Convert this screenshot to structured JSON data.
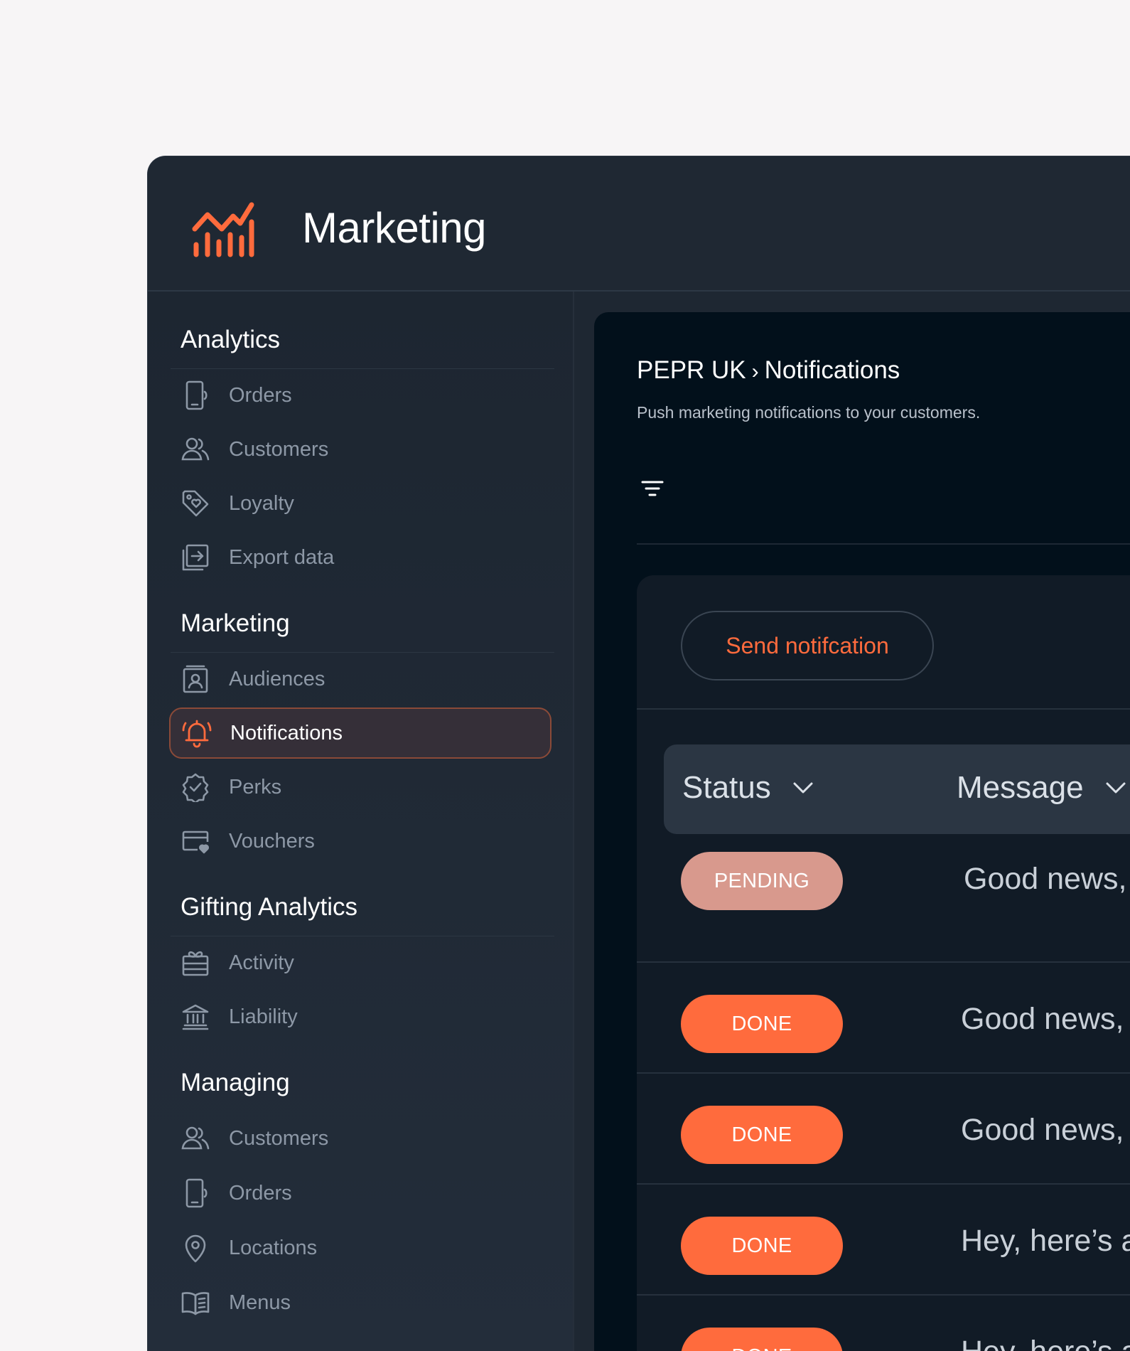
{
  "app": {
    "title": "Marketing",
    "accent_color": "#ff6b3d",
    "logo_icon": "chart-growth-icon"
  },
  "sidebar": {
    "sections": [
      {
        "title": "Analytics",
        "items": [
          {
            "label": "Orders",
            "icon": "phone-order-icon"
          },
          {
            "label": "Customers",
            "icon": "users-icon"
          },
          {
            "label": "Loyalty",
            "icon": "tag-heart-icon"
          },
          {
            "label": "Export data",
            "icon": "export-icon"
          }
        ]
      },
      {
        "title": "Marketing",
        "items": [
          {
            "label": "Audiences",
            "icon": "contact-card-icon"
          },
          {
            "label": "Notifications",
            "icon": "bell-icon",
            "active": true
          },
          {
            "label": "Perks",
            "icon": "badge-check-icon"
          },
          {
            "label": "Vouchers",
            "icon": "card-heart-icon"
          }
        ]
      },
      {
        "title": "Gifting Analytics",
        "items": [
          {
            "label": "Activity",
            "icon": "gift-card-icon"
          },
          {
            "label": "Liability",
            "icon": "bank-icon"
          }
        ]
      },
      {
        "title": "Managing",
        "items": [
          {
            "label": "Customers",
            "icon": "users-icon"
          },
          {
            "label": "Orders",
            "icon": "phone-order-icon"
          },
          {
            "label": "Locations",
            "icon": "map-pin-icon"
          },
          {
            "label": "Menus",
            "icon": "book-icon"
          }
        ]
      }
    ]
  },
  "main": {
    "breadcrumb": {
      "parent": "PEPR UK",
      "separator": "›",
      "current": "Notifications"
    },
    "subtitle": "Push marketing notifications to your customers.",
    "filter_icon": "filter-icon",
    "send_button": "Send notifcation",
    "table": {
      "columns": [
        "Status",
        "Message"
      ],
      "rows": [
        {
          "status": "PENDING",
          "message": "Good news, y"
        },
        {
          "status": "DONE",
          "message": "Good news, y"
        },
        {
          "status": "DONE",
          "message": "Good news, y"
        },
        {
          "status": "DONE",
          "message": "Hey, here’s a"
        },
        {
          "status": "DONE",
          "message": "Hey, here’s a"
        }
      ]
    }
  }
}
